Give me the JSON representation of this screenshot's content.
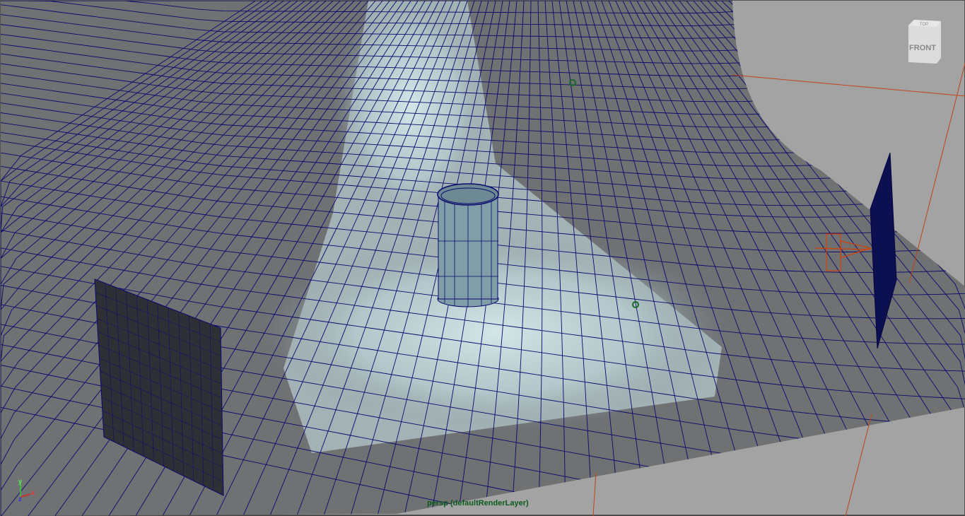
{
  "viewport": {
    "camera_label": "persp (defaultRenderLayer)",
    "view_cube": {
      "front": "FRONT",
      "top": "TOP"
    },
    "axis": {
      "x": "x",
      "y": "y",
      "z": "z"
    }
  },
  "colors": {
    "grid": "#0a0a6e",
    "surface": "#6e6e6e",
    "light": "#cfe3e6",
    "label": "#0b5a1e",
    "camera": "#d4400a"
  }
}
